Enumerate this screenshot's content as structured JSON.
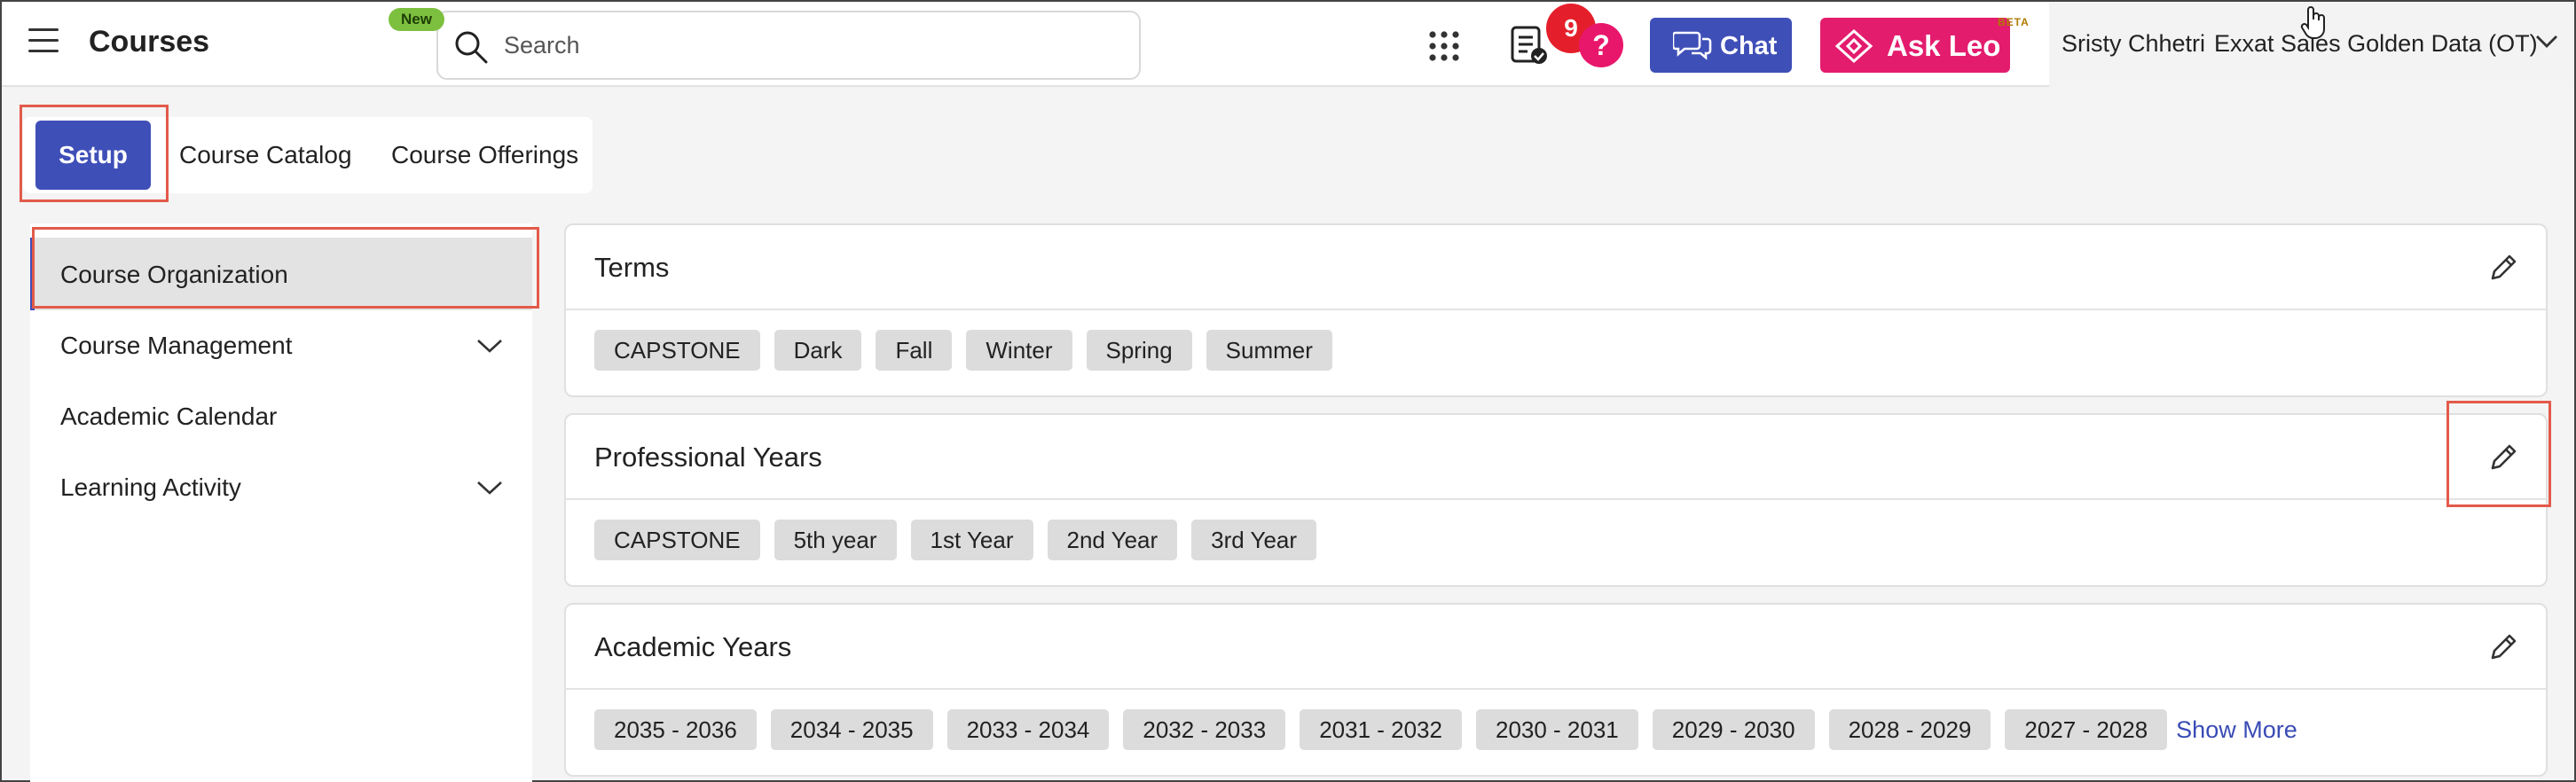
{
  "header": {
    "app_title": "Courses",
    "search_placeholder": "Search",
    "new_badge": "New",
    "notification_count": "9",
    "help_label": "?",
    "chat_label": "Chat",
    "ask_leo_label": "Ask Leo",
    "beta_badge": "BETA",
    "user_name": "Sristy Chhetri",
    "org_name": "Exxat Sales Golden Data (OT)",
    "accent_color": "#3f4fb8",
    "leo_color": "#e31c6e"
  },
  "tabs": [
    {
      "label": "Setup",
      "active": true
    },
    {
      "label": "Course Catalog",
      "active": false
    },
    {
      "label": "Course Offerings",
      "active": false
    }
  ],
  "sidebar": {
    "items": [
      {
        "label": "Course Organization",
        "active": true,
        "expandable": false
      },
      {
        "label": "Course Management",
        "active": false,
        "expandable": true
      },
      {
        "label": "Academic Calendar",
        "active": false,
        "expandable": false
      },
      {
        "label": "Learning Activity",
        "active": false,
        "expandable": true
      }
    ]
  },
  "sections": [
    {
      "title": "Terms",
      "chips": [
        "CAPSTONE",
        "Dark",
        "Fall",
        "Winter",
        "Spring",
        "Summer"
      ]
    },
    {
      "title": "Professional Years",
      "chips": [
        "CAPSTONE",
        "5th year",
        "1st Year",
        "2nd Year",
        "3rd Year"
      ]
    },
    {
      "title": "Academic Years",
      "chips": [
        "2035 - 2036",
        "2034 - 2035",
        "2033 - 2034",
        "2032 - 2033",
        "2031 - 2032",
        "2030 - 2031",
        "2029 - 2030",
        "2028 - 2029",
        "2027 - 2028"
      ],
      "show_more": "Show More"
    }
  ]
}
